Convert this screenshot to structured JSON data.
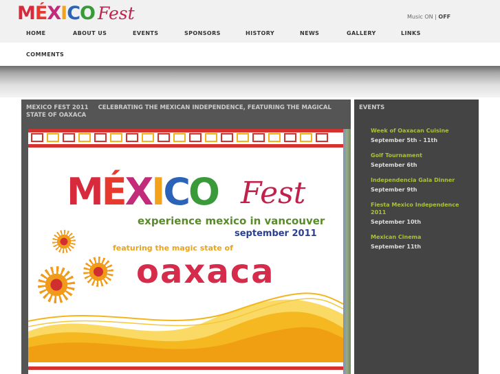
{
  "logo": {
    "mexico_letters": [
      {
        "char": "M",
        "color": "#d72a3c"
      },
      {
        "char": "É",
        "color": "#e8392f"
      },
      {
        "char": "X",
        "color": "#c22a7a"
      },
      {
        "char": "I",
        "color": "#f3a21c"
      },
      {
        "char": "C",
        "color": "#2a63b8"
      },
      {
        "char": "O",
        "color": "#3a9a3a"
      }
    ],
    "fest": "Fest"
  },
  "music": {
    "label": "Music",
    "on": "ON",
    "separator": "|",
    "off": "OFF"
  },
  "nav": {
    "items": [
      "HOME",
      "ABOUT US",
      "EVENTS",
      "SPONSORS",
      "HISTORY",
      "NEWS",
      "GALLERY",
      "LINKS"
    ],
    "second_row": "COMMENTS"
  },
  "main": {
    "title_left": "MEXICO FEST 2011",
    "title_right": "CELEBRATING THE MEXICAN INDEPENDENCE, FEATURING THE MAGICAL STATE OF OAXACA"
  },
  "poster": {
    "mexico_letters": [
      {
        "char": "M",
        "color": "#d72a3c"
      },
      {
        "char": "É",
        "color": "#e8392f"
      },
      {
        "char": "X",
        "color": "#c22a7a"
      },
      {
        "char": "I",
        "color": "#f3a21c"
      },
      {
        "char": "C",
        "color": "#2a63b8"
      },
      {
        "char": "O",
        "color": "#3a9a3a"
      }
    ],
    "fest": "Fest",
    "tagline": "experience mexico in vancouver",
    "date": "september 2011",
    "featuring": "featuring the magic state of",
    "state": "oaxaca"
  },
  "sidebar": {
    "title": "EVENTS",
    "events": [
      {
        "title": "Week of Oaxacan Cuisine",
        "date": "September 5th - 11th"
      },
      {
        "title": "Golf Tournament",
        "date": "September 6th"
      },
      {
        "title": "Independencia Gala Dinner",
        "date": "September 9th"
      },
      {
        "title": "Fiesta Mexico Independence 2011",
        "date": "September 10th"
      },
      {
        "title": "Mexican Cinema",
        "date": "September 11th"
      }
    ]
  },
  "colors": {
    "accent_green": "#a9c23d",
    "brand_red": "#d62c4b",
    "panel_dark": "#444444"
  }
}
